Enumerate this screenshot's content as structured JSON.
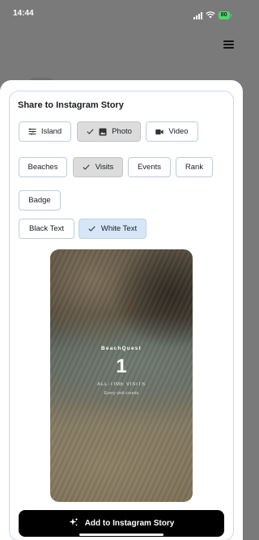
{
  "status_bar": {
    "time": "14:44",
    "battery": "80",
    "icons": [
      "signal-icon",
      "wifi-icon",
      "battery-icon"
    ]
  },
  "colors": {
    "card_border": "#c9d8ec",
    "selected_grey": "#dcdcdc",
    "selected_blue": "#d6e6f6",
    "primary_button": "#000000",
    "battery": "#4cd964"
  },
  "sheet": {
    "title": "Share to Instagram Story",
    "source_tabs": [
      {
        "label": "Island",
        "icon": "map-layers-icon",
        "selected": false
      },
      {
        "label": "Photo",
        "icon": "image-icon",
        "selected": true
      },
      {
        "label": "Video",
        "icon": "video-camera-icon",
        "selected": false
      }
    ],
    "content_tabs": [
      {
        "label": "Beaches",
        "selected": false
      },
      {
        "label": "Visits",
        "selected": true
      },
      {
        "label": "Events",
        "selected": false
      },
      {
        "label": "Rank",
        "selected": false
      },
      {
        "label": "Badge",
        "selected": false
      }
    ],
    "text_color_tabs": [
      {
        "label": "Black Text",
        "selected": false
      },
      {
        "label": "White Text",
        "selected": true
      }
    ],
    "preview": {
      "brand": "BeachQuest",
      "number": "1",
      "caption": "ALL-TIME VISITS",
      "subcaption": "Every visit counts"
    },
    "action_button": {
      "label": "Add to Instagram Story",
      "icon": "sparkles-icon"
    }
  }
}
